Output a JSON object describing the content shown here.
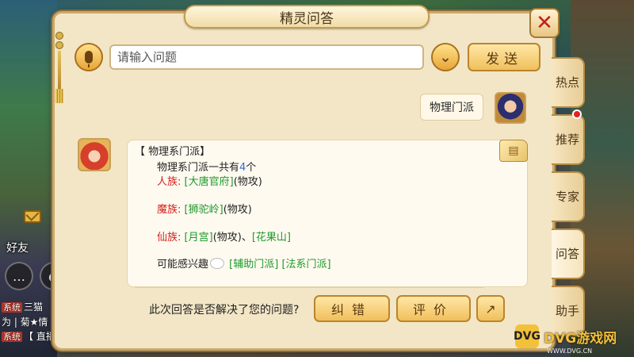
{
  "window": {
    "title": "精灵问答",
    "close_glyph": "✕"
  },
  "search": {
    "placeholder": "请输入问题",
    "value": "",
    "send_label": "发送",
    "dropdown_glyph": "⌄"
  },
  "conversation": {
    "user_message": "物理门派",
    "answer": {
      "heading": "【 物理系门派】",
      "summary_prefix": "物理系门派一共有",
      "summary_count": "4",
      "summary_suffix": "个",
      "lines": [
        {
          "race": "人族:",
          "links": [
            "[大唐官府]"
          ],
          "notes": [
            "(物攻)"
          ]
        },
        {
          "race": "魔族:",
          "links": [
            "[狮驼岭]"
          ],
          "notes": [
            "(物攻)"
          ]
        },
        {
          "race": "仙族:",
          "links": [
            "[月宫]",
            "[花果山]"
          ],
          "notes": [
            "(物攻)、"
          ]
        }
      ],
      "interest_label": "可能感兴趣",
      "interest_links": [
        "[辅助门派]",
        "[法系门派]"
      ]
    }
  },
  "feedback": {
    "question": "此次回答是否解决了您的问题?",
    "fix_label": "纠错",
    "rate_label": "评价",
    "share_icon": "share-icon"
  },
  "tabs": [
    {
      "label": "热点"
    },
    {
      "label": "推荐",
      "badge": true
    },
    {
      "label": "专家"
    },
    {
      "label": "问答",
      "active": true
    },
    {
      "label": "助手"
    }
  ],
  "game_hud": {
    "friends_label": "好友",
    "chat_lines": [
      {
        "tag": "系统",
        "text": "三猫"
      },
      {
        "tag": "",
        "text": "为 | 菊★情"
      },
      {
        "tag": "系统",
        "text": "【 直播"
      }
    ]
  },
  "watermark": {
    "logo": "DVG",
    "text": "DVG游戏网",
    "sub": "WWW.DVG.CN"
  },
  "colors": {
    "race": "#d2211d",
    "link": "#1e9a2b",
    "count": "#2f6fd1",
    "panel": "#f3e6c7"
  }
}
